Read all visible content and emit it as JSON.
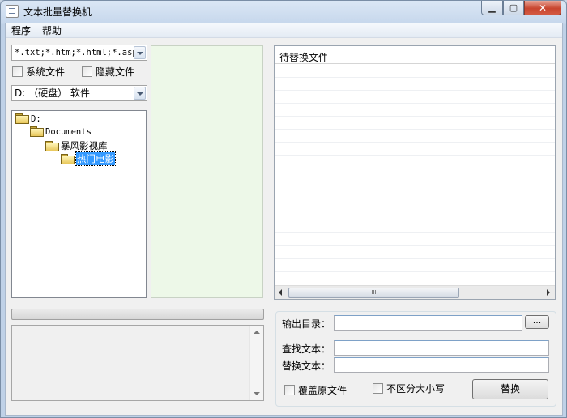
{
  "window": {
    "title": "文本批量替换机"
  },
  "menu": [
    {
      "label": "程序"
    },
    {
      "label": "帮助"
    }
  ],
  "filter": {
    "value": "*.txt;*.htm;*.html;*.asp"
  },
  "options": {
    "system_files": "系统文件",
    "hidden_files": "隐藏文件"
  },
  "drive": {
    "value": "D: （硬盘） 软件"
  },
  "tree": [
    {
      "label": "D:",
      "level": 0
    },
    {
      "label": "Documents",
      "level": 1
    },
    {
      "label": "暴风影视库",
      "level": 2
    },
    {
      "label": "热门电影",
      "level": 3,
      "selected": true
    }
  ],
  "list": {
    "header": "待替换文件",
    "scroll_grip": "III"
  },
  "form": {
    "output_label": "输出目录：",
    "output_value": "",
    "browse_label": "...",
    "find_label": "查找文本：",
    "find_value": "",
    "replace_label": "替换文本：",
    "replace_value": "",
    "overwrite_label": "覆盖原文件",
    "case_label": "不区分大小写",
    "start_label": "替换"
  },
  "colors": {
    "file_panel_bg": "#edf8e8",
    "selection": "#3399ff",
    "close_button": "#c8452f"
  }
}
